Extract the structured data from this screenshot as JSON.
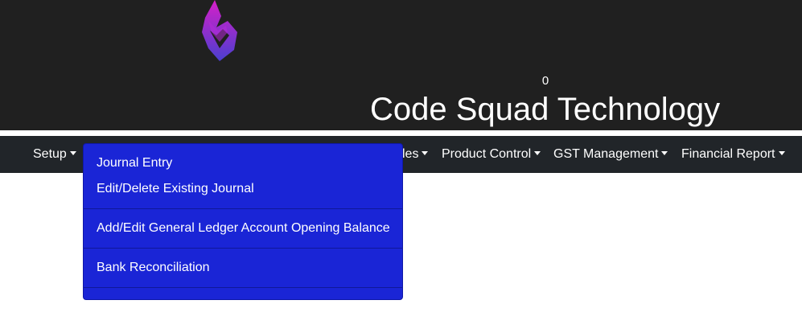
{
  "header": {
    "counter": "0",
    "brand_name": "Code Squad Technology",
    "logo_icon": "shield-logo-icon",
    "logo_colors": [
      "#c21fd6",
      "#5b4bd6"
    ]
  },
  "nav": {
    "items": [
      {
        "label": "Setup"
      },
      {
        "label": "les"
      },
      {
        "label": "Product Control"
      },
      {
        "label": "GST Management"
      },
      {
        "label": "Financial Report"
      }
    ]
  },
  "dropdown": {
    "items": [
      {
        "label": "Journal Entry"
      },
      {
        "label": "Edit/Delete Existing Journal"
      },
      {
        "label": "Add/Edit General Ledger Account Opening Balance"
      },
      {
        "label": "Bank Reconciliation"
      }
    ],
    "background": "#1a25d6"
  }
}
